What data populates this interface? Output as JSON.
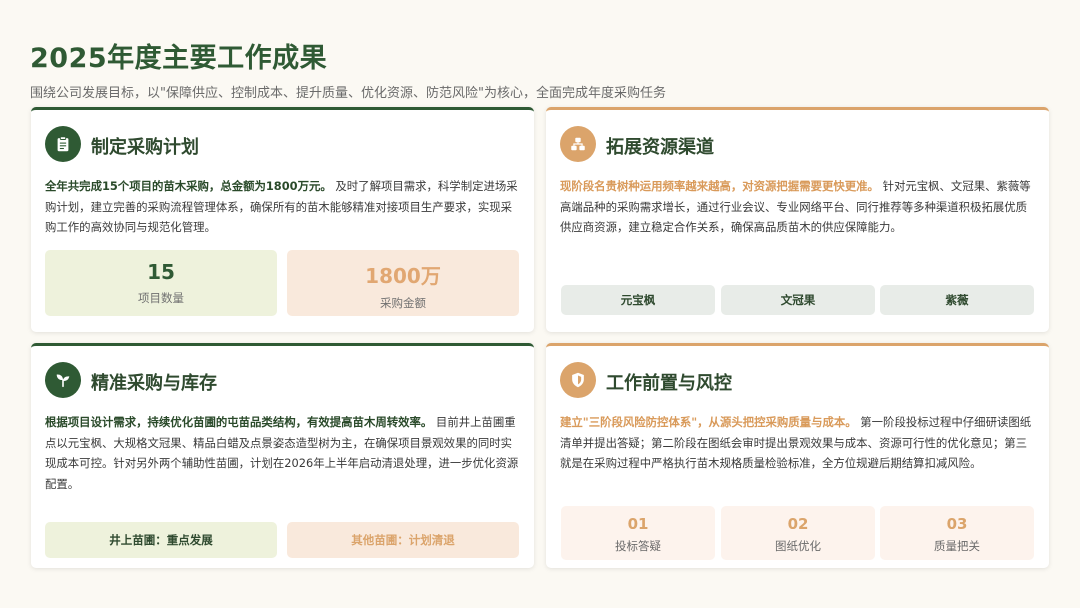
{
  "page": {
    "title": "2025年度主要工作成果",
    "subtitle": "围绕公司发展目标，以\"保障供应、控制成本、提升质量、优化资源、防范风险\"为核心，全面完成年度采购任务"
  },
  "colors": {
    "primary_green": "#2f5a34",
    "accent_orange": "#dba46b",
    "light_green_bg": "#eef2dc",
    "light_beige_bg": "#f9e9dc"
  },
  "cards": {
    "plan": {
      "icon": "clipboard-icon",
      "title": "制定采购计划",
      "highlight": "全年共完成15个项目的苗木采购，总金额为1800万元。",
      "text": "及时了解项目需求，科学制定进场采购计划，建立完善的采购流程管理体系，确保所有的苗木能够精准对接项目生产要求，实现采购工作的高效协同与规范化管理。",
      "stats": [
        {
          "value": "15",
          "label": "项目数量"
        },
        {
          "value": "1800万",
          "label": "采购金额"
        }
      ]
    },
    "channels": {
      "icon": "network-icon",
      "title": "拓展资源渠道",
      "highlight": "现阶段名贵树种运用频率越来越高，对资源把握需要更快更准。",
      "text": "针对元宝枫、文冠果、紫薇等高端品种的采购需求增长，通过行业会议、专业网络平台、同行推荐等多种渠道积极拓展优质供应商资源，建立稳定合作关系，确保高品质苗木的供应保障能力。",
      "tags": [
        "元宝枫",
        "文冠果",
        "紫薇"
      ]
    },
    "inventory": {
      "icon": "sprout-icon",
      "title": "精准采购与库存",
      "highlight": "根据项目设计需求，持续优化苗圃的屯苗品类结构，有效提高苗木周转效率。",
      "text": "目前井上苗圃重点以元宝枫、大规格文冠果、精品白蜡及点景姿态造型树为主，在确保项目景观效果的同时实现成本可控。针对另外两个辅助性苗圃，计划在2026年上半年启动清退处理，进一步优化资源配置。",
      "pills": [
        "井上苗圃：重点发展",
        "其他苗圃：计划清退"
      ]
    },
    "risk": {
      "icon": "shield-icon",
      "title": "工作前置与风控",
      "highlight": "建立\"三阶段风险防控体系\"，从源头把控采购质量与成本。",
      "text": "第一阶段投标过程中仔细研读图纸清单并提出答疑；第二阶段在图纸会审时提出景观效果与成本、资源可行性的优化意见；第三就是在采购过程中严格执行苗木规格质量检验标准，全方位规避后期结算扣减风险。",
      "steps": [
        {
          "num": "01",
          "label": "投标答疑"
        },
        {
          "num": "02",
          "label": "图纸优化"
        },
        {
          "num": "03",
          "label": "质量把关"
        }
      ]
    }
  }
}
